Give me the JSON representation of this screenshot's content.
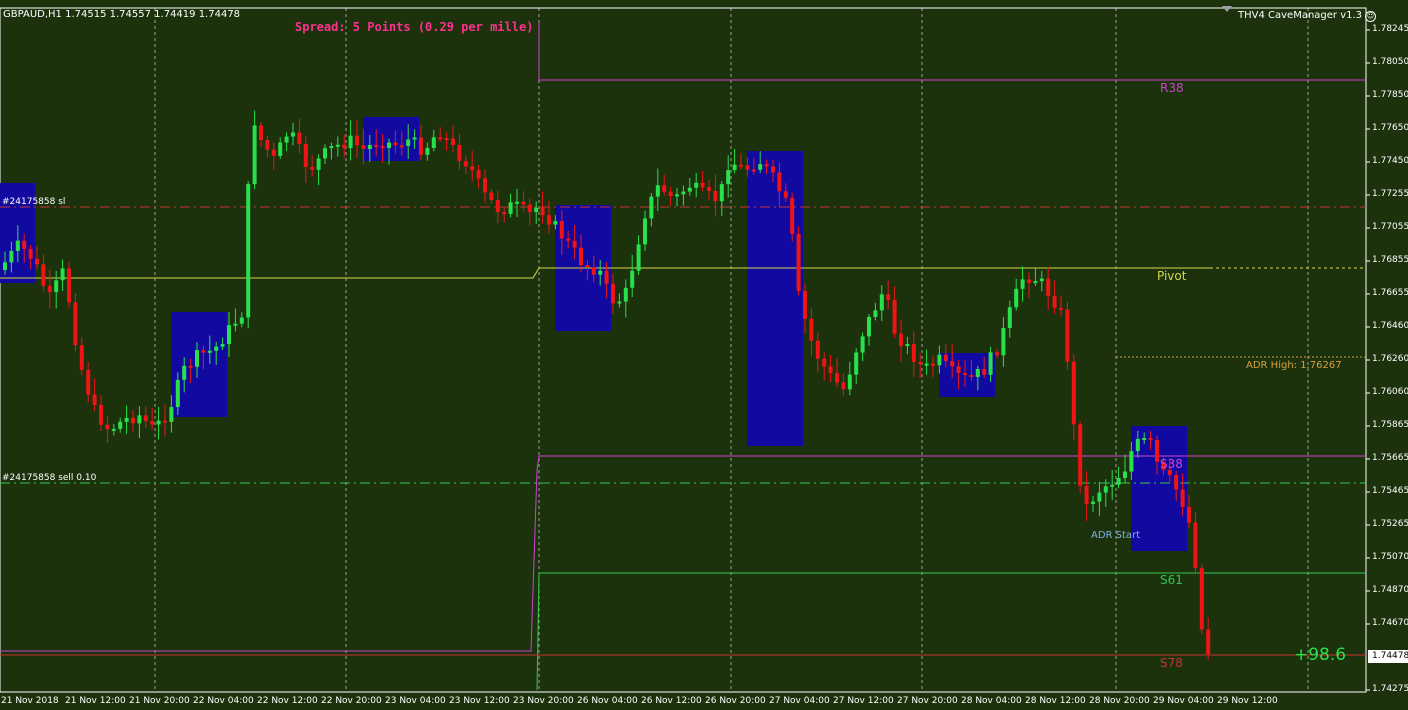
{
  "header": {
    "symbol_info": "GBPAUD,H1  1.74515 1.74557 1.74419 1.74478",
    "spread_text": "Spread: 5 Points (0.29 per mille)",
    "indicator_name": "THV4 CaveManager v1.3",
    "indicator_icon": "smiley-icon"
  },
  "orders": {
    "sl_label": "#24175858 sl",
    "sell_label": "#24175858 sell 0.10"
  },
  "levels": {
    "r38": "R38",
    "pivot": "Pivot",
    "adr_high": "ADR High: 1.76267",
    "s38": "S38",
    "adr_start": "ADR Start",
    "s61": "S61",
    "s78": "S78"
  },
  "profit": "+98.6",
  "current_price": "1.74478",
  "price_axis": [
    "1.78245",
    "1.78050",
    "1.77850",
    "1.77650",
    "1.77450",
    "1.77255",
    "1.77055",
    "1.76855",
    "1.76655",
    "1.76460",
    "1.76260",
    "1.76060",
    "1.75865",
    "1.75665",
    "1.75465",
    "1.75265",
    "1.75070",
    "1.74870",
    "1.74670",
    "1.74478",
    "1.74275"
  ],
  "time_axis": [
    "21 Nov 2018",
    "21 Nov 12:00",
    "21 Nov 20:00",
    "22 Nov 04:00",
    "22 Nov 12:00",
    "22 Nov 20:00",
    "23 Nov 04:00",
    "23 Nov 12:00",
    "23 Nov 20:00",
    "26 Nov 04:00",
    "26 Nov 12:00",
    "26 Nov 20:00",
    "27 Nov 04:00",
    "27 Nov 12:00",
    "27 Nov 20:00",
    "28 Nov 04:00",
    "28 Nov 12:00",
    "28 Nov 20:00",
    "29 Nov 04:00",
    "29 Nov 12:00"
  ],
  "colors": {
    "background": "#1b320d",
    "bull_candle": "#28e14a",
    "bear_candle": "#f01414",
    "zone_box": "#120aa0",
    "pivot_line": "#d7d74a",
    "r38_line": "#cc44cc",
    "s61_line": "#32c850",
    "s78_line": "#c83232",
    "adr_high_line": "#d7a040",
    "sl_line": "#c83232",
    "sell_line": "#32c850"
  }
}
